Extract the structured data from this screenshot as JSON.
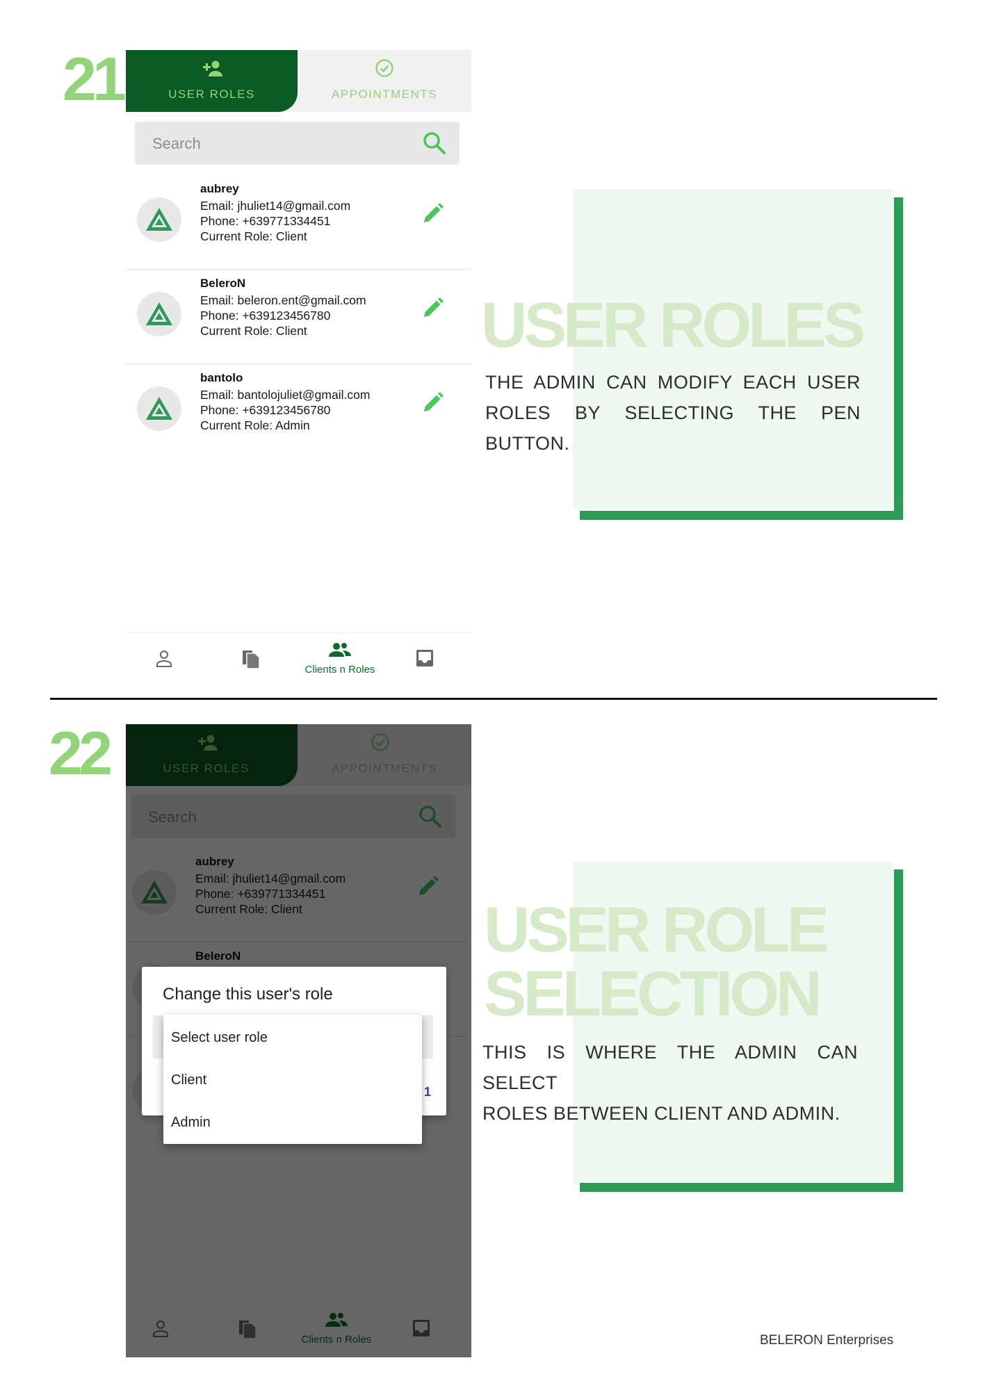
{
  "steps": {
    "first": "21",
    "second": "22"
  },
  "tabs": {
    "user_roles": "USER ROLES",
    "appointments": "APPOINTMENTS"
  },
  "search": {
    "placeholder": "Search"
  },
  "users": [
    {
      "name": "aubrey",
      "email": "Email: jhuliet14@gmail.com",
      "phone": "Phone: +639771334451",
      "role": "Current Role: Client"
    },
    {
      "name": "BeleroN",
      "email": "Email: beleron.ent@gmail.com",
      "phone": "Phone: +639123456780",
      "role": "Current Role: Client"
    },
    {
      "name": "bantolo",
      "email": "Email: bantolojuliet@gmail.com",
      "phone": "Phone: +639123456780",
      "role": "Current Role: Admin"
    }
  ],
  "bottom_nav": {
    "active_label": "Clients n Roles"
  },
  "section1": {
    "title": "USER ROLES",
    "desc_line1": "THE ADMIN CAN MODIFY EACH USER",
    "desc_line2": "ROLES BY SELECTING THE PEN BUTTON."
  },
  "section2": {
    "title_line1": "USER ROLE",
    "title_line2": "SELECTION",
    "desc_line1": "THIS IS WHERE THE ADMIN CAN SELECT",
    "desc_line2": "ROLES BETWEEN CLIENT AND ADMIN."
  },
  "dialog": {
    "title": "Change this user's role",
    "options": [
      "Select user role",
      "Client",
      "Admin"
    ],
    "peek_char": "1"
  },
  "footer": "BELERON Enterprises",
  "colors": {
    "dark_green": "#0a5a24",
    "light_green": "#93d37a",
    "accent_green": "#2e9a57",
    "panel_bg": "#eff9f1"
  }
}
